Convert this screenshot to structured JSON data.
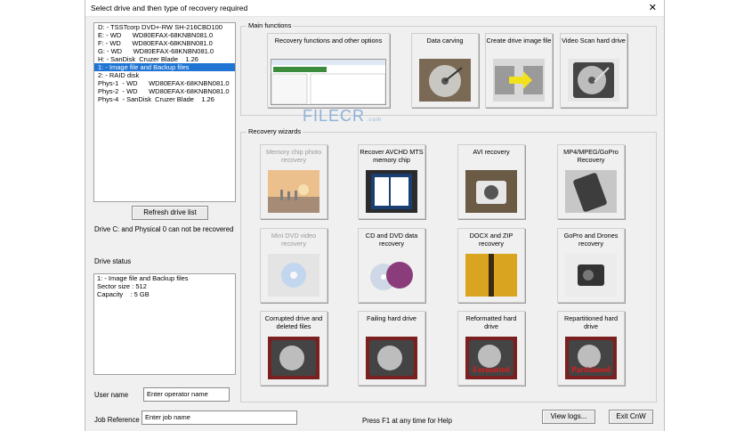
{
  "window": {
    "title": "Select drive and then type of recovery required",
    "close_glyph": "✕"
  },
  "drives": [
    {
      "label": "D: - TSSTcorp DVD+-RW SH-216CBD100",
      "selected": false
    },
    {
      "label": "E: - WD      WD80EFAX-68KNBN081.0",
      "selected": false
    },
    {
      "label": "F: - WD      WD80EFAX-68KNBN081.0",
      "selected": false
    },
    {
      "label": "G: - WD      WD80EFAX-68KNBN081.0",
      "selected": false
    },
    {
      "label": "H: - SanDisk  Cruzer Blade    1.26",
      "selected": false
    },
    {
      "label": "1: - Image file and Backup files",
      "selected": true
    },
    {
      "label": "2: - RAID disk",
      "selected": false
    },
    {
      "label": "Phys-1  - WD      WD80EFAX-68KNBN081.0",
      "selected": false
    },
    {
      "label": "Phys-2  - WD      WD80EFAX-68KNBN081.0",
      "selected": false
    },
    {
      "label": "Phys-4  - SanDisk  Cruzer Blade    1.26",
      "selected": false
    }
  ],
  "left": {
    "refresh_button": "Refresh drive list",
    "warning": "Drive C: and Physical 0 can not be recovered",
    "drive_status_label": "Drive status",
    "status_lines": [
      "1: - Image file and Backup files",
      "Sector size : 512",
      "Capacity    : 5 GB"
    ],
    "user_name_label": "User name",
    "user_name_value": "Enter operator name",
    "job_ref_label": "Job Reference",
    "job_ref_value": "Enter job name"
  },
  "main_functions": {
    "title": "Main functions",
    "items": [
      {
        "label": "Recovery functions and other options",
        "icon": "software-screenshot-icon"
      },
      {
        "label": "Data carving",
        "icon": "open-hard-drive-icon"
      },
      {
        "label": "Create drive image file",
        "icon": "drive-copy-icon"
      },
      {
        "label": "Video Scan hard drive",
        "icon": "hard-drive-platter-icon"
      }
    ]
  },
  "wizards": {
    "title": "Recovery wizards",
    "items": [
      {
        "label": "Memory chip photo recovery",
        "disabled": true,
        "icon": "sunset-photo-icon"
      },
      {
        "label": "Recover AVCHD MTS memory chip",
        "disabled": false,
        "icon": "sd-card-icon"
      },
      {
        "label": "AVI recovery",
        "disabled": false,
        "icon": "camera-icon"
      },
      {
        "label": "MP4/MPEG/GoPro Recovery",
        "disabled": false,
        "icon": "phone-icon"
      },
      {
        "label": "Mini DVD video recovery",
        "disabled": true,
        "icon": "mini-dvd-icon"
      },
      {
        "label": "CD and DVD data recovery",
        "disabled": false,
        "icon": "cd-dvd-icon"
      },
      {
        "label": "DOCX and ZIP recovery",
        "disabled": false,
        "icon": "zip-icon"
      },
      {
        "label": "GoPro and Drones recovery",
        "disabled": false,
        "icon": "gopro-icon"
      },
      {
        "label": "Corrupted drive and deleted files",
        "disabled": false,
        "icon": "corrupted-drive-icon"
      },
      {
        "label": "Failing hard drive",
        "disabled": false,
        "icon": "failing-drive-icon"
      },
      {
        "label": "Reformatted hard drive",
        "disabled": false,
        "icon": "formatted-drive-icon",
        "stamp": "Formatted"
      },
      {
        "label": "Repartitioned hard drive",
        "disabled": false,
        "icon": "partitioned-drive-icon",
        "stamp": "Partitioned"
      }
    ]
  },
  "footer": {
    "help": "Press F1 at any time for Help",
    "view_logs": "View logs...",
    "exit": "Exit CnW"
  },
  "watermark": {
    "text": "FILECR",
    "sub": ".com"
  }
}
